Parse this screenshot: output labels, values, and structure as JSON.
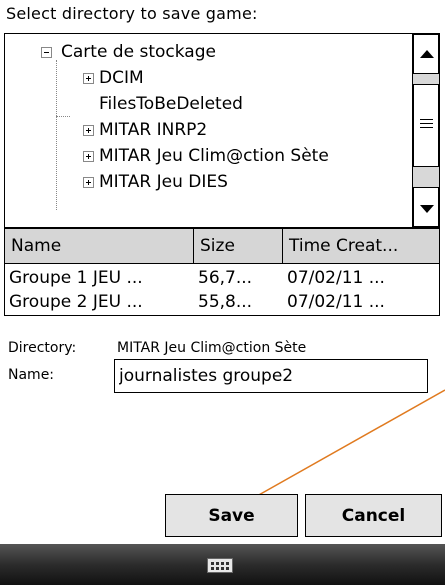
{
  "prompt": "Select directory to save game:",
  "tree": {
    "root": "Carte de stockage",
    "children": [
      {
        "label": "DCIM",
        "expander": "plus"
      },
      {
        "label": "FilesToBeDeleted",
        "expander": "none"
      },
      {
        "label": "MITAR INRP2",
        "expander": "plus"
      },
      {
        "label": "MITAR Jeu Clim@ction  Sète",
        "expander": "plus"
      },
      {
        "label": "MITAR Jeu DIES",
        "expander": "plus"
      }
    ]
  },
  "list": {
    "columns": [
      "Name",
      "Size",
      "Time Creat..."
    ],
    "rows": [
      [
        "Groupe 1 JEU ...",
        "56,7...",
        "07/02/11 ..."
      ],
      [
        "Groupe 2 JEU ...",
        "55,8...",
        "07/02/11 ..."
      ]
    ]
  },
  "form": {
    "directory_label": "Directory:",
    "directory_value": "MITAR Jeu Clim@ction  Sète",
    "name_label": "Name:",
    "name_value": "journalistes groupe2"
  },
  "buttons": {
    "save": "Save",
    "cancel": "Cancel"
  },
  "icons": {
    "keyboard": "keyboard-icon"
  },
  "colors": {
    "annotation_line": "#e07a1f"
  }
}
